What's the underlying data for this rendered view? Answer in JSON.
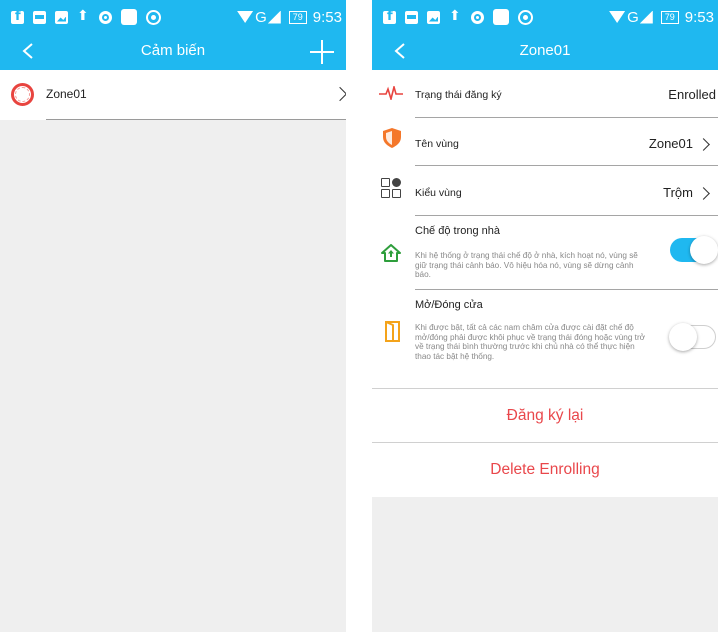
{
  "status_bar": {
    "network": "G",
    "battery": "79",
    "time": "9:53",
    "icons": [
      "facebook-icon",
      "zalo-icon",
      "gallery-icon",
      "upload-icon",
      "ring-icon",
      "app-icon",
      "eye-icon"
    ]
  },
  "screen_left": {
    "title": "Cảm biến",
    "sensors": [
      {
        "name": "Zone01",
        "icon": "ring-sensor-icon"
      }
    ]
  },
  "screen_right": {
    "title": "Zone01",
    "enroll_status": {
      "label": "Trạng thái đăng ký",
      "value": "Enrolled",
      "icon": "pulse-icon"
    },
    "zone_name": {
      "label": "Tên vùng",
      "value": "Zone01",
      "icon": "shield-icon"
    },
    "zone_type": {
      "label": "Kiểu vùng",
      "value": "Trộm",
      "icon": "zone-type-icon"
    },
    "home_mode": {
      "title": "Chế độ trong nhà",
      "description": "Khi hệ thống ở trạng thái chế độ ở nhà, kích hoạt nó, vùng sẽ giữ trạng thái cảnh báo. Vô hiệu hóa nó, vùng sẽ dừng cảnh báo.",
      "enabled": true,
      "icon": "home-icon"
    },
    "door_mode": {
      "title": "Mở/Đóng cửa",
      "description": "Khi được bật, tất cả các nam châm cửa được cài đặt chế độ mở/đóng phải được khôi phục về trạng thái đóng hoặc vùng trở về trạng thái bình thường trước khi chủ nhà có thể thực hiện thao tác bật hệ thống.",
      "enabled": false,
      "icon": "door-icon"
    },
    "actions": {
      "re_enroll": "Đăng ký lại",
      "delete": "Delete Enrolling"
    }
  },
  "colors": {
    "primary": "#1fb8f0",
    "danger": "#e9474b",
    "sensor_ring": "#e8443f",
    "shield": "#f4772a",
    "home": "#2e9e3c",
    "door": "#f4a31a"
  }
}
